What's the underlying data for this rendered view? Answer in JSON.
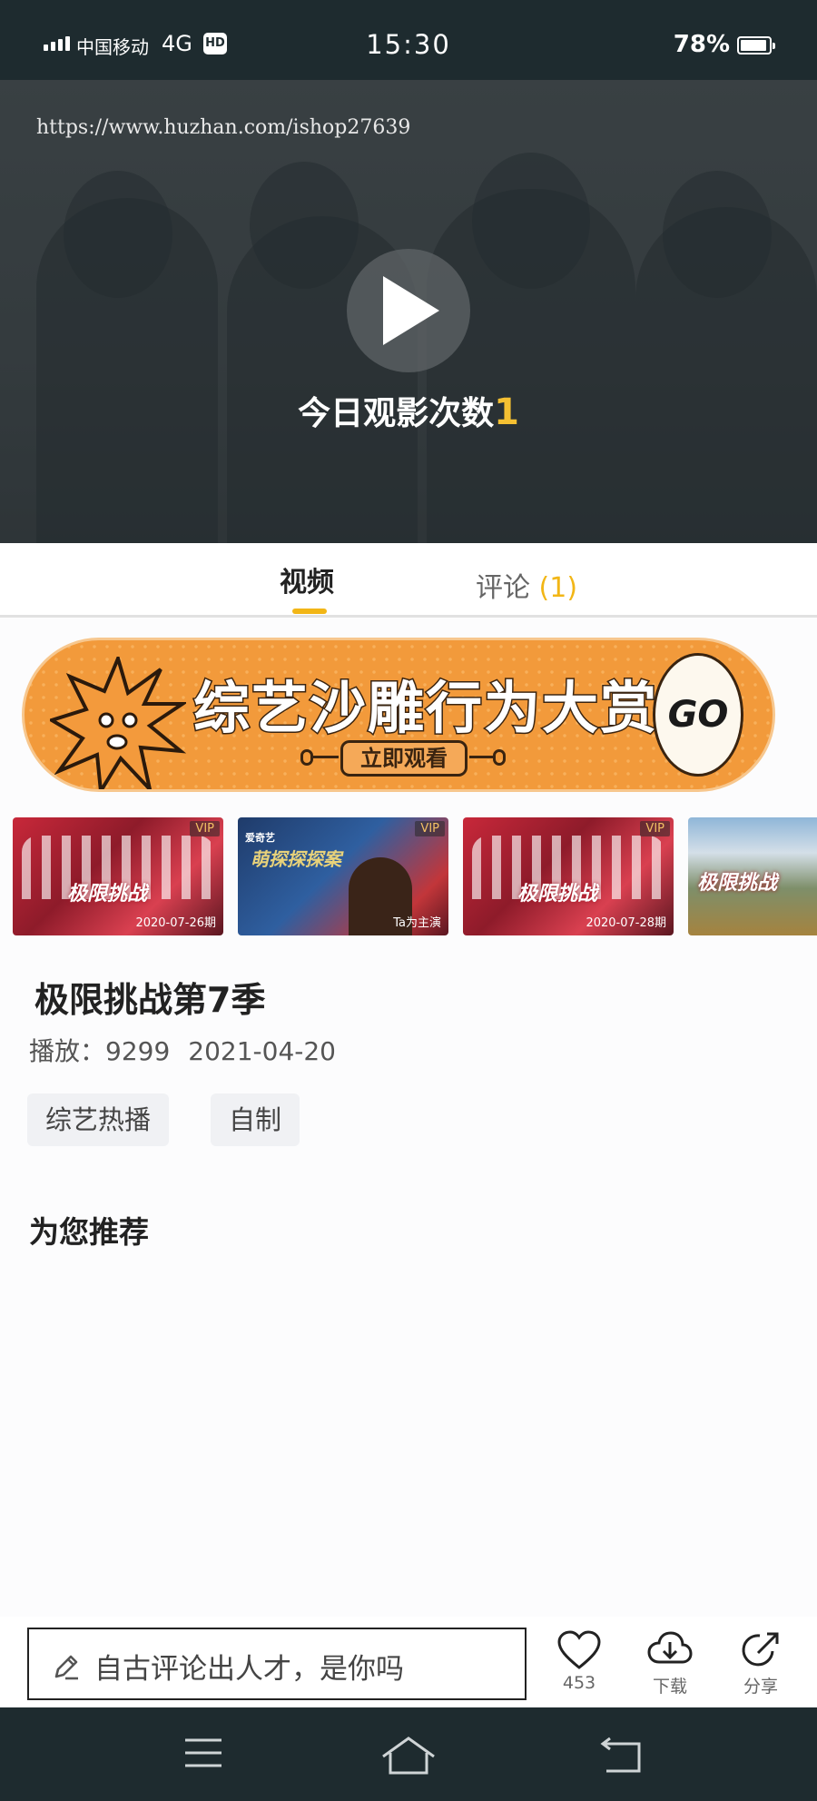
{
  "status_bar": {
    "carrier": "中国移动",
    "network": "4G",
    "hd_badge": "HD",
    "time": "15:30",
    "battery": "78%"
  },
  "video": {
    "watermark": "https://www.huzhan.com/ishop27639",
    "views_label": "今日观影次数",
    "views_count": "1",
    "play_icon": "play-icon"
  },
  "tabs": {
    "video": "视频",
    "comments": "评论",
    "comments_count": "(1)"
  },
  "banner": {
    "title": "综艺沙雕行为大赏",
    "subtitle": "立即观看",
    "go": "GO"
  },
  "episodes": [
    {
      "vip": "VIP",
      "date": "2020-07-26期",
      "logo": "极限挑战"
    },
    {
      "vip": "VIP",
      "caption": "Ta为主演",
      "brand": "萌探探探案",
      "top": "爱奇艺"
    },
    {
      "vip": "VIP",
      "date": "2020-07-28期",
      "logo": "极限挑战"
    },
    {
      "logo": "极限挑战"
    }
  ],
  "show": {
    "title": "极限挑战第7季",
    "play_label": "播放：9299",
    "date": "2021-04-20",
    "tags": [
      "综艺热播",
      "自制"
    ]
  },
  "recommend_title": "为您推荐",
  "bottom_bar": {
    "comment_placeholder": "自古评论出人才，是你吗",
    "like_count": "453",
    "download_label": "下载",
    "share_label": "分享"
  },
  "colors": {
    "accent": "#f2b616",
    "dark": "#1e2b2f",
    "banner_orange": "#f29a3b"
  }
}
